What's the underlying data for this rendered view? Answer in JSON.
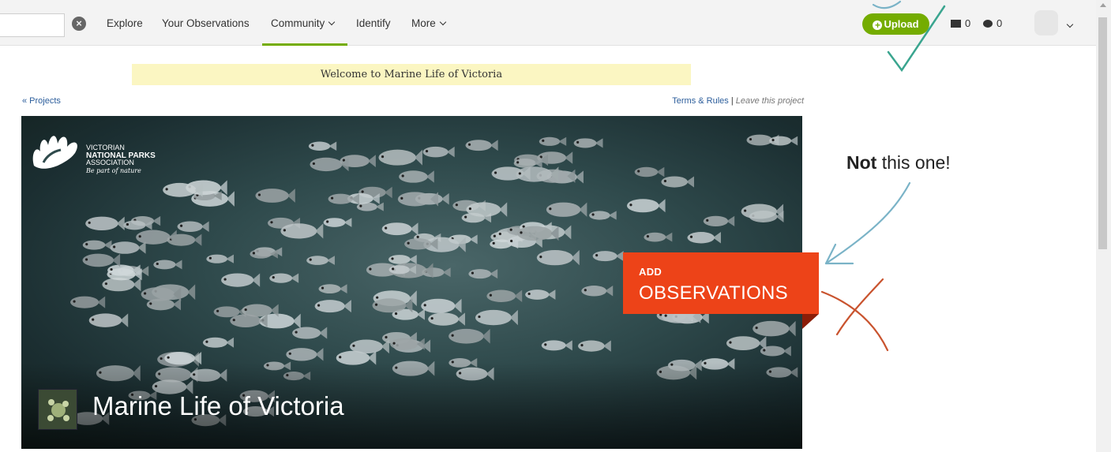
{
  "nav": {
    "search_placeholder": "",
    "items": [
      {
        "label": "Explore"
      },
      {
        "label": "Your Observations"
      },
      {
        "label": "Community"
      },
      {
        "label": "Identify"
      },
      {
        "label": "More"
      }
    ],
    "active_item": "Community",
    "upload_label": "Upload",
    "messages_count": "0",
    "notifications_count": "0"
  },
  "banner": {
    "welcome_text": "Welcome to Marine Life of Victoria"
  },
  "links": {
    "projects": "« Projects",
    "terms": "Terms & Rules",
    "separator": "|",
    "leave": "Leave this project"
  },
  "hero": {
    "logo_lines": [
      "VICTORIAN",
      "NATIONAL PARKS",
      "ASSOCIATION",
      "Be part of nature"
    ],
    "project_title": "Marine Life of Victoria",
    "add_obs_small": "ADD",
    "add_obs_big": "OBSERVATIONS"
  },
  "annotation": {
    "bold": "Not",
    "rest": " this one!"
  },
  "colors": {
    "brand_green": "#74ac00",
    "add_obs_orange": "#ed4318",
    "banner_yellow": "#fbf6c2",
    "check_teal": "#3aa58f",
    "arrow_blue": "#7ab3c7",
    "cross_orange": "#c9532e"
  }
}
